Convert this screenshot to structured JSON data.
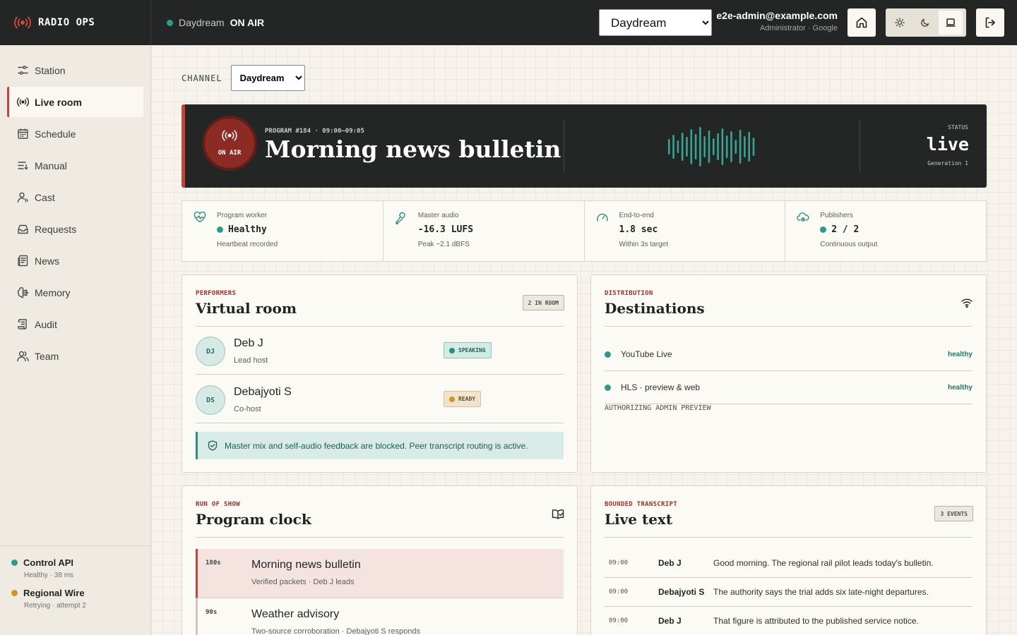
{
  "app": {
    "name": "RADIO OPS"
  },
  "topbar": {
    "channel": "Daydream",
    "on_air_label": "ON AIR",
    "channel_select_value": "Daydream",
    "user_email": "e2e-admin@example.com",
    "user_role": "Administrator · Google"
  },
  "sidebar": {
    "items": [
      {
        "label": "Station",
        "icon": "sliders-icon"
      },
      {
        "label": "Live room",
        "icon": "broadcast-icon",
        "active": true
      },
      {
        "label": "Schedule",
        "icon": "calendar-icon"
      },
      {
        "label": "Manual",
        "icon": "list-icon"
      },
      {
        "label": "Cast",
        "icon": "user-voice-icon"
      },
      {
        "label": "Requests",
        "icon": "inbox-icon"
      },
      {
        "label": "News",
        "icon": "newspaper-icon"
      },
      {
        "label": "Memory",
        "icon": "brain-icon"
      },
      {
        "label": "Audit",
        "icon": "scroll-icon"
      },
      {
        "label": "Team",
        "icon": "users-icon"
      }
    ],
    "services": [
      {
        "name": "Control API",
        "detail": "Healthy · 38 ms",
        "status_color": "#2f9a8a"
      },
      {
        "name": "Regional Wire",
        "detail": "Retrying · attempt 2",
        "status_color": "#d1952d"
      }
    ]
  },
  "channel": {
    "label": "CHANNEL",
    "value": "Daydream"
  },
  "hero": {
    "badge": "ON AIR",
    "meta": "PROGRAM #184 · 09:00–09:05",
    "title": "Morning news bulletin",
    "status_label": "STATUS",
    "status_value": "live",
    "generation": "Generation 1"
  },
  "metrics": [
    {
      "label": "Program worker",
      "value": "Healthy",
      "sub": "Heartbeat recorded",
      "dot": true,
      "icon": "heart-pulse-icon"
    },
    {
      "label": "Master audio",
      "value": "-16.3 LUFS",
      "sub": "Peak −2.1 dBFS",
      "dot": false,
      "icon": "microphone-icon"
    },
    {
      "label": "End-to-end",
      "value": "1.8 sec",
      "sub": "Within 3s target",
      "dot": false,
      "icon": "gauge-icon"
    },
    {
      "label": "Publishers",
      "value": "2 / 2",
      "sub": "Continuous output",
      "dot": true,
      "icon": "cloud-upload-icon"
    }
  ],
  "performers": {
    "kicker": "PERFORMERS",
    "title": "Virtual room",
    "count": "2 IN ROOM",
    "list": [
      {
        "initials": "DJ",
        "name": "Deb J",
        "role": "Lead host",
        "state": "SPEAKING"
      },
      {
        "initials": "DS",
        "name": "Debajyoti S",
        "role": "Co-host",
        "state": "READY"
      }
    ],
    "notice": "Master mix and self-audio feedback are blocked. Peer transcript routing is active."
  },
  "destinations": {
    "kicker": "DISTRIBUTION",
    "title": "Destinations",
    "list": [
      {
        "name": "YouTube Live",
        "state": "healthy"
      },
      {
        "name": "HLS · preview & web",
        "state": "healthy"
      }
    ],
    "authorizing": "AUTHORIZING ADMIN PREVIEW"
  },
  "program_clock": {
    "kicker": "RUN OF SHOW",
    "title": "Program clock",
    "items": [
      {
        "duration": "180s",
        "title": "Morning news bulletin",
        "sub": "Verified packets · Deb J leads",
        "current": true
      },
      {
        "duration": "90s",
        "title": "Weather advisory",
        "sub": "Two-source corroboration · Debajyoti S responds",
        "current": false
      }
    ]
  },
  "transcript": {
    "kicker": "BOUNDED TRANSCRIPT",
    "title": "Live text",
    "count": "3 EVENTS",
    "lines": [
      {
        "time": "09:00",
        "who": "Deb J",
        "text": "Good morning. The regional rail pilot leads today's bulletin."
      },
      {
        "time": "09:00",
        "who": "Debajyoti S",
        "text": "The authority says the trial adds six late-night departures."
      },
      {
        "time": "09:00",
        "who": "Deb J",
        "text": "That figure is attributed to the published service notice."
      }
    ]
  },
  "colors": {
    "accent": "#c5433a",
    "teal": "#2f9a8a",
    "dark": "#232624",
    "amber": "#d1952d"
  }
}
